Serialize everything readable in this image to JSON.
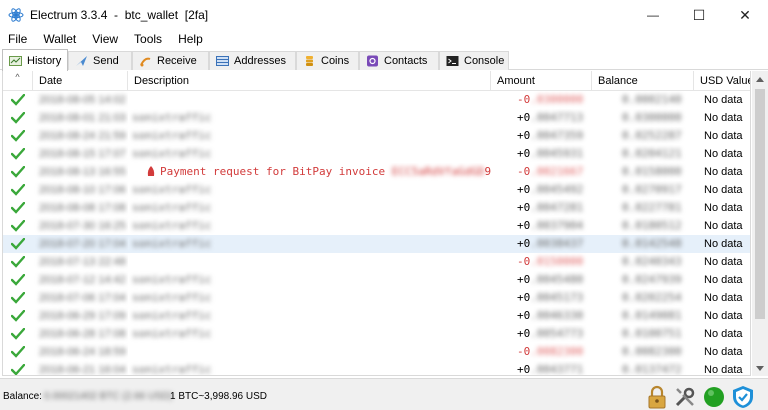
{
  "window": {
    "title": "Electrum 3.3.4  -  btc_wallet  [2fa]",
    "minimize_glyph": "—",
    "maximize_glyph": "☐",
    "close_glyph": "✕"
  },
  "menu": [
    "File",
    "Wallet",
    "View",
    "Tools",
    "Help"
  ],
  "tabs": [
    {
      "label": "History",
      "icon": "history-icon",
      "active": true
    },
    {
      "label": "Send",
      "icon": "send-icon"
    },
    {
      "label": "Receive",
      "icon": "receive-icon"
    },
    {
      "label": "Addresses",
      "icon": "addresses-icon"
    },
    {
      "label": "Coins",
      "icon": "coins-icon"
    },
    {
      "label": "Contacts",
      "icon": "contacts-icon"
    },
    {
      "label": "Console",
      "icon": "console-icon"
    }
  ],
  "table": {
    "sort_indicator": "^",
    "columns": [
      "Date",
      "Description",
      "Amount",
      "Balance",
      "USD Value"
    ],
    "rows": [
      {
        "date": "2018-08-05 14:02",
        "desc": "",
        "amount": "-0.0300000",
        "balance": "0.0002140",
        "usd": "No data",
        "neg": true
      },
      {
        "date": "2018-08-01 21:03",
        "desc": "sonixtraffic",
        "amount": "+0.0047713",
        "balance": "0.0300000",
        "usd": "No data"
      },
      {
        "date": "2018-08-24 21:59",
        "desc": "sonixtraffic",
        "amount": "+0.0047359",
        "balance": "0.0252287",
        "usd": "No data"
      },
      {
        "date": "2018-08-15 17:07",
        "desc": "sonixtraffic",
        "amount": "+0.0045931",
        "balance": "0.0204121",
        "usd": "No data"
      },
      {
        "date": "2018-08-13 16:55",
        "desc_prefix": "Payment request for BitPay invoice ",
        "desc_blur": "ECC5aRdVfaGdGD",
        "desc_suffix": "9…",
        "amount": "-0.0021667",
        "balance": "0.0158000",
        "usd": "No data",
        "neg": true,
        "has_request_icon": true
      },
      {
        "date": "2018-08-10 17:06",
        "desc": "sonixtraffic",
        "amount": "+0.0045492",
        "balance": "0.0270917",
        "usd": "No data"
      },
      {
        "date": "2018-08-08 17:08",
        "desc": "sonixtraffic",
        "amount": "+0.0047281",
        "balance": "0.0227781",
        "usd": "No data"
      },
      {
        "date": "2018-07-30 16:25",
        "desc": "sonixtraffic",
        "amount": "+0.0037904",
        "balance": "0.0180512",
        "usd": "No data"
      },
      {
        "date": "2018-07-20 17:04",
        "desc": "sonixtraffic",
        "amount": "+0.0038437",
        "balance": "0.0142548",
        "usd": "No data",
        "selected": true
      },
      {
        "date": "2018-07-13 22:48",
        "desc": "",
        "amount": "-0.0150000",
        "balance": "0.0240343",
        "usd": "No data",
        "neg": true
      },
      {
        "date": "2018-07-12 14:42",
        "desc": "sonixtraffic",
        "amount": "+0.0045480",
        "balance": "0.0247939",
        "usd": "No data"
      },
      {
        "date": "2018-07-06 17:04",
        "desc": "sonixtraffic",
        "amount": "+0.0045173",
        "balance": "0.0202254",
        "usd": "No data"
      },
      {
        "date": "2018-06-29 17:09",
        "desc": "sonixtraffic",
        "amount": "+0.0046330",
        "balance": "0.0149081",
        "usd": "No data"
      },
      {
        "date": "2018-06-28 17:08",
        "desc": "sonixtraffic",
        "amount": "+0.0054773",
        "balance": "0.0100751",
        "usd": "No data"
      },
      {
        "date": "2018-06-24 18:59",
        "desc": "",
        "amount": "-0.0082300",
        "balance": "0.0082300",
        "usd": "No data",
        "neg": true
      },
      {
        "date": "2018-06-21 16:04",
        "desc": "sonixtraffic",
        "amount": "+0.0043771",
        "balance": "0.0137472",
        "usd": "No data"
      },
      {
        "date": "2018-06-15 17:08",
        "desc": "sonixtraffic",
        "amount": "+0.0043750",
        "balance": "0.0093701",
        "usd": "No data"
      }
    ]
  },
  "status": {
    "label": "Balance:",
    "amount": "0.00021402 BTC (2.66 USD)",
    "rate": "1 BTC~3,998.96 USD"
  },
  "colors": {
    "negative": "#d23b3b",
    "check": "#3aa83a",
    "selected_row": "#e6f0fa",
    "network_ok": "#22a022",
    "shield": "#1e90d8"
  }
}
